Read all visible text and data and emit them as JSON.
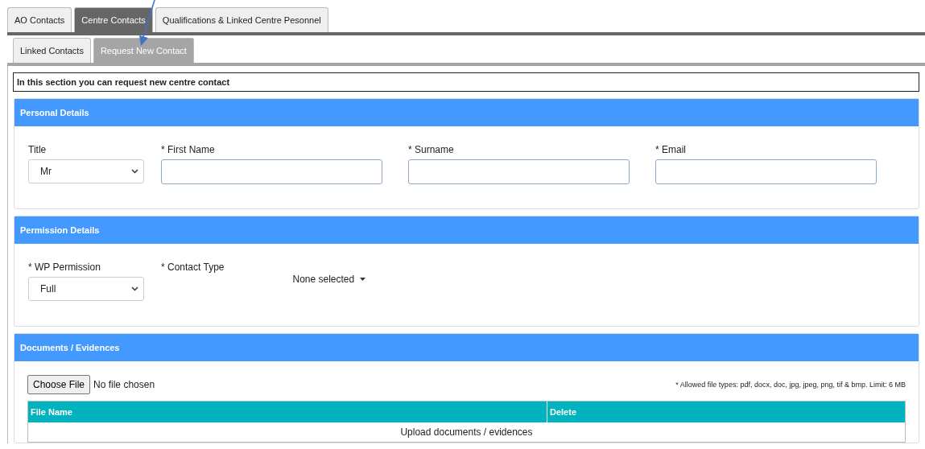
{
  "tabs": [
    {
      "label": "AO Contacts",
      "selected": false
    },
    {
      "label": "Centre Contacts",
      "selected": true
    },
    {
      "label": "Qualifications & Linked Centre Pesonnel",
      "selected": false
    }
  ],
  "subtabs": [
    {
      "label": "Linked Contacts",
      "selected": false
    },
    {
      "label": "Request New Contact",
      "selected": true
    }
  ],
  "intro": "In this section you can request new centre contact",
  "personal": {
    "title": "Personal Details",
    "fields": [
      {
        "kind": "select",
        "label": "Title",
        "value": "Mr"
      },
      {
        "kind": "input",
        "label": "* First Name"
      },
      {
        "kind": "input",
        "label": "* Surname"
      },
      {
        "kind": "input",
        "label": "* Email"
      }
    ]
  },
  "permission": {
    "title": "Permission Details",
    "fields": [
      {
        "kind": "select",
        "label": "* WP Permission",
        "value": "Full"
      },
      {
        "kind": "multiselect",
        "label": "* Contact Type",
        "value": "None selected"
      }
    ]
  },
  "documents": {
    "title": "Documents / Evidences",
    "choose_button": "Choose File",
    "file_status": "No file chosen",
    "note": "* Allowed file types: pdf, docx, doc, jpg, jpeg, png, tif & bmp. Limit: 6 MB",
    "table": {
      "columns": [
        "File Name",
        "Delete"
      ],
      "empty_text": "Upload documents / evidences"
    }
  }
}
